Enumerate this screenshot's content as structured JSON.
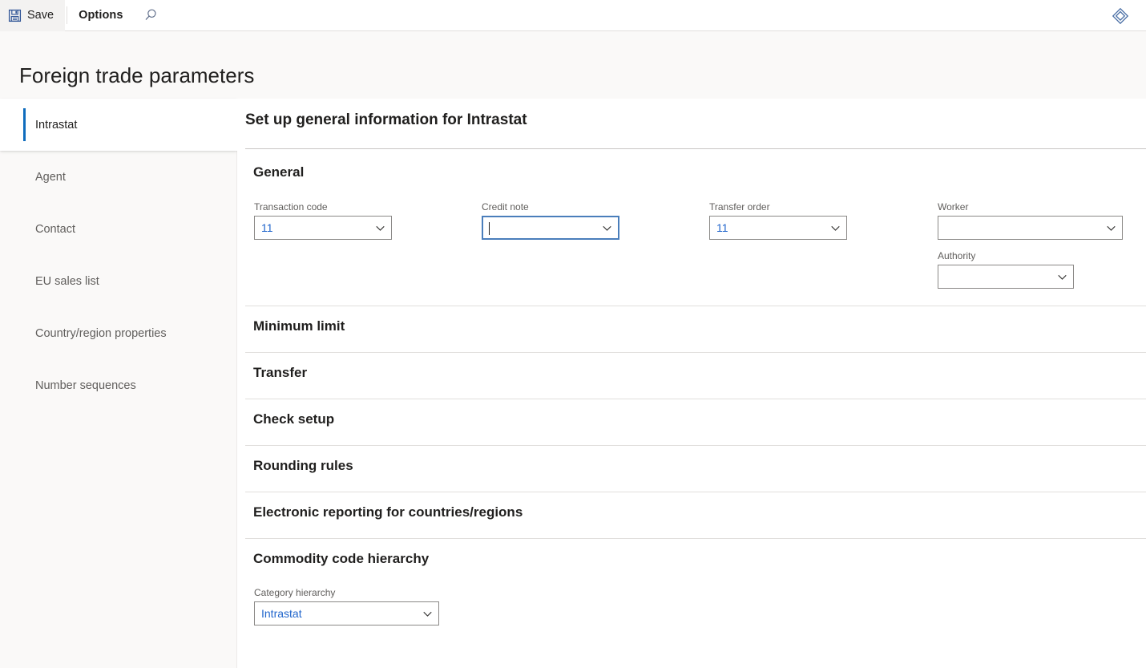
{
  "toolbar": {
    "save_label": "Save",
    "options_label": "Options",
    "search_icon": "search-icon",
    "save_icon": "save-floppy-icon",
    "brand_icon": "dynamics-diamond-icon"
  },
  "header": {
    "page_title": "Foreign trade parameters"
  },
  "sidebar": {
    "items": [
      {
        "label": "Intrastat",
        "selected": true
      },
      {
        "label": "Agent",
        "selected": false
      },
      {
        "label": "Contact",
        "selected": false
      },
      {
        "label": "EU sales list",
        "selected": false
      },
      {
        "label": "Country/region properties",
        "selected": false
      },
      {
        "label": "Number sequences",
        "selected": false
      }
    ]
  },
  "main": {
    "heading": "Set up general information for Intrastat",
    "general": {
      "title": "General",
      "fields": {
        "transaction_code": {
          "label": "Transaction code",
          "value": "11",
          "focused": false
        },
        "credit_note": {
          "label": "Credit note",
          "value": "",
          "focused": true
        },
        "transfer_order": {
          "label": "Transfer order",
          "value": "11",
          "focused": false
        },
        "worker": {
          "label": "Worker",
          "value": "",
          "focused": false
        },
        "authority": {
          "label": "Authority",
          "value": "",
          "focused": false
        }
      }
    },
    "sections": [
      {
        "title": "Minimum limit"
      },
      {
        "title": "Transfer"
      },
      {
        "title": "Check setup"
      },
      {
        "title": "Rounding rules"
      },
      {
        "title": "Electronic reporting for countries/regions"
      }
    ],
    "commodity": {
      "title": "Commodity code hierarchy",
      "category_hierarchy": {
        "label": "Category hierarchy",
        "value": "Intrastat"
      }
    }
  },
  "colors": {
    "accent": "#0f6cbd",
    "value_text": "#2266cc",
    "focus_border": "#4a7ebb",
    "page_bg": "#faf9f8",
    "border": "#8a8886"
  }
}
